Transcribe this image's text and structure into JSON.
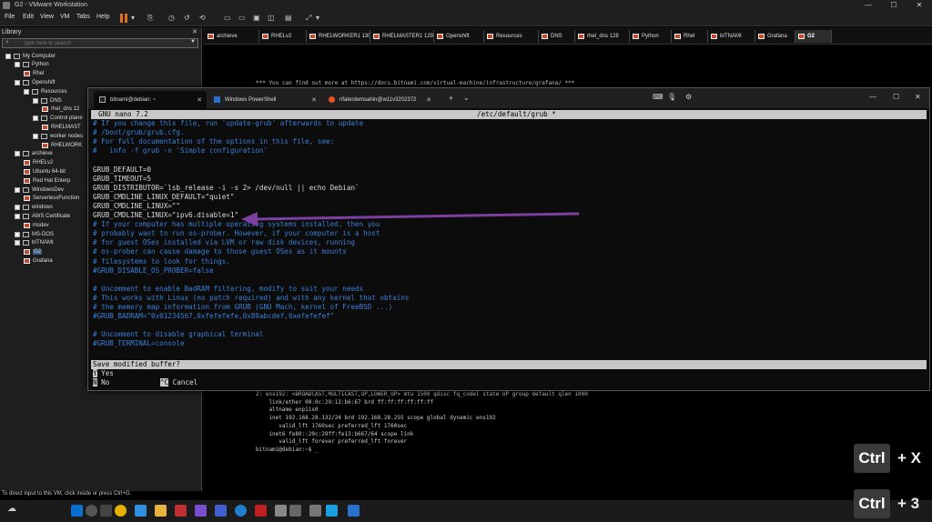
{
  "window": {
    "title": "G2 - VMware Workstation",
    "minimize": "—",
    "maximize": "☐",
    "close": "✕"
  },
  "menu": [
    "File",
    "Edit",
    "View",
    "VM",
    "Tabs",
    "Help"
  ],
  "library": {
    "title": "Library",
    "close": "✕",
    "search_placeholder": "Type here to search",
    "tree": [
      {
        "label": "My Computer",
        "depth": 0,
        "kind": "folder"
      },
      {
        "label": "Python",
        "depth": 1,
        "kind": "folder"
      },
      {
        "label": "Rhel",
        "depth": 2,
        "kind": "vm"
      },
      {
        "label": "Openshift",
        "depth": 1,
        "kind": "folder"
      },
      {
        "label": "Resources",
        "depth": 2,
        "kind": "folder"
      },
      {
        "label": "DNS",
        "depth": 3,
        "kind": "folder"
      },
      {
        "label": "rhel_dns 12",
        "depth": 4,
        "kind": "vm"
      },
      {
        "label": "Control plane",
        "depth": 3,
        "kind": "folder"
      },
      {
        "label": "RHELMAST",
        "depth": 4,
        "kind": "vm"
      },
      {
        "label": "worker nodes",
        "depth": 3,
        "kind": "folder"
      },
      {
        "label": "RHELWORK",
        "depth": 4,
        "kind": "vm"
      },
      {
        "label": "archieve",
        "depth": 1,
        "kind": "folder"
      },
      {
        "label": "RHELv2",
        "depth": 2,
        "kind": "vm"
      },
      {
        "label": "Ubuntu 64-bit",
        "depth": 2,
        "kind": "vm"
      },
      {
        "label": "Red Hat Enterp",
        "depth": 2,
        "kind": "vm"
      },
      {
        "label": "WindowsDev",
        "depth": 1,
        "kind": "folder"
      },
      {
        "label": "ServerlessFunction",
        "depth": 2,
        "kind": "vm"
      },
      {
        "label": "windows",
        "depth": 1,
        "kind": "folder"
      },
      {
        "label": "AWS Certificate",
        "depth": 1,
        "kind": "folder"
      },
      {
        "label": "msdev",
        "depth": 2,
        "kind": "vm"
      },
      {
        "label": "MS-DOS",
        "depth": 1,
        "kind": "folder"
      },
      {
        "label": "bITNAMI",
        "depth": 1,
        "kind": "folder"
      },
      {
        "label": "G2",
        "depth": 2,
        "kind": "vm",
        "selected": true
      },
      {
        "label": "Grafana",
        "depth": 2,
        "kind": "vm"
      }
    ]
  },
  "vm_tabs": [
    "archieve",
    "RHELv2",
    "RHELWORKER1 130",
    "RHELMASTER1 129",
    "Openshift",
    "Resources",
    "DNS",
    "rhel_dns 128",
    "Python",
    "Rhel",
    "bITNAMI",
    "Grafana",
    "G2"
  ],
  "vm_console": {
    "top_line": "*** You can find out more at https://docs.bitnami.com/virtual-machine/infrastructure/grafana/ ***",
    "bottom_lines": [
      "2: ens192: <BROADCAST,MULTICAST,UP,LOWER_UP> mtu 1500 qdisc fq_codel state UP group default qlen 1000",
      "    link/ether 00:0c:29:13:b6:67 brd ff:ff:ff:ff:ff:ff",
      "    altname enp11s0",
      "    inet 192.168.28.132/24 brd 192.168.28.255 scope global dynamic ens192",
      "       valid_lft 1760sec preferred_lft 1760sec",
      "    inet6 fe80::20c:29ff:fe13:b667/64 scope link",
      "       valid_lft forever preferred_lft forever",
      "bitnami@debian:~$ _"
    ]
  },
  "status_text": "To direct input to this VM, click inside or press Ctrl+G.",
  "terminal": {
    "tabs": [
      "bitnami@debian: ~",
      "Windows PowerShell",
      "rifaterdemsahin@w11v3202372"
    ],
    "new_tab": "+",
    "tab_menu": "⌄",
    "min": "—",
    "max": "☐",
    "close": "✕"
  },
  "nano": {
    "version": "GNU nano 7.2",
    "filename": "/etc/default/grub *",
    "lines": [
      {
        "t": "# If you change this file, run 'update-grub' afterwards to update",
        "c": "cm"
      },
      {
        "t": "# /boot/grub/grub.cfg.",
        "c": "cm"
      },
      {
        "t": "# For full documentation of the options in this file, see:",
        "c": "cm"
      },
      {
        "t": "#   info -f grub -n 'Simple configuration'",
        "c": "cm"
      },
      {
        "t": "",
        "c": "wt"
      },
      {
        "t": "GRUB_DEFAULT=0",
        "c": "wt"
      },
      {
        "t": "GRUB_TIMEOUT=5",
        "c": "wt"
      },
      {
        "t": "GRUB_DISTRIBUTOR=`lsb_release -i -s 2> /dev/null || echo Debian`",
        "c": "wt"
      },
      {
        "t": "GRUB_CMDLINE_LINUX_DEFAULT=\"quiet\"",
        "c": "wt"
      },
      {
        "t": "GRUB_CMDLINE_LINUX=\"\"",
        "c": "wt"
      },
      {
        "t": "GRUB_CMDLINE_LINUX=\"ipv6.disable=1\"",
        "c": "wt"
      },
      {
        "t": "# If your computer has multiple operating systems installed, then you",
        "c": "cm"
      },
      {
        "t": "# probably want to run os-prober. However, if your computer is a host",
        "c": "cm"
      },
      {
        "t": "# for guest OSes installed via LVM or raw disk devices, running",
        "c": "cm"
      },
      {
        "t": "# os-prober can cause damage to those guest OSes as it mounts",
        "c": "cm"
      },
      {
        "t": "# filesystems to look for things.",
        "c": "cm"
      },
      {
        "t": "#GRUB_DISABLE_OS_PROBER=false",
        "c": "cm"
      },
      {
        "t": "",
        "c": "wt"
      },
      {
        "t": "# Uncomment to enable BadRAM filtering, modify to suit your needs",
        "c": "cm"
      },
      {
        "t": "# This works with Linux (no patch required) and with any kernel that obtains",
        "c": "cm"
      },
      {
        "t": "# the memory map information from GRUB (GNU Mach, kernel of FreeBSD ...)",
        "c": "cm"
      },
      {
        "t": "#GRUB_BADRAM=\"0x01234567,0xfefefefe,0x89abcdef,0xefefefef\"",
        "c": "cm"
      },
      {
        "t": "",
        "c": "wt"
      },
      {
        "t": "# Uncomment to disable graphical terminal",
        "c": "cm"
      },
      {
        "t": "#GRUB_TERMINAL=console",
        "c": "cm"
      }
    ],
    "prompt": "Save modified buffer?",
    "yes_key": "Y",
    "yes_label": "Yes",
    "no_key": "N",
    "no_label": "No",
    "cancel_key": "^C",
    "cancel_label": "Cancel"
  },
  "overlay": {
    "key1": "Ctrl",
    "plus1": "+ X",
    "key2": "Ctrl",
    "plus2": "+ 3"
  },
  "colors": {
    "accent": "#7b3fa0",
    "comment": "#3a7fd5",
    "vmicon": "#c24a2e"
  }
}
